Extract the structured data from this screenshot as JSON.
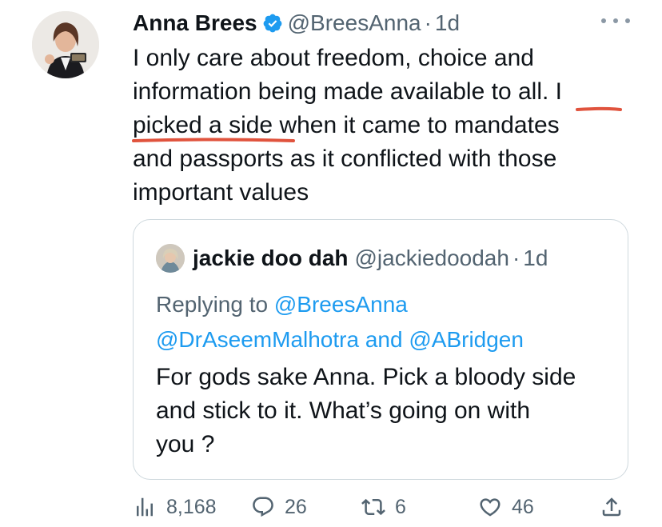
{
  "tweet": {
    "author": {
      "display_name": "Anna Brees",
      "handle": "@BreesAnna",
      "verified": true,
      "verified_color": "#1d9bf0"
    },
    "separator": "·",
    "time": "1d",
    "text_lines": [
      "I only care about freedom, choice and",
      "information being made available to all. I",
      "picked a side when it came to mandates",
      "and passports as it conflicted with those",
      "important values"
    ],
    "annotation_color": "#e0533d",
    "quoted_tweet": {
      "display_name": "jackie doo dah",
      "handle": "@jackiedoodah",
      "separator": "·",
      "time": "1d",
      "replying_to_label": "Replying to",
      "mention_1": "@BreesAnna",
      "mention_2": "@DrAseemMalhotra",
      "mentions_joiner": "and",
      "mention_3": "@ABridgen",
      "text_lines": [
        "For gods sake Anna. Pick a bloody side",
        "and stick to it. What’s going on with",
        "you ?"
      ]
    },
    "actions": {
      "views": {
        "icon": "analytics-icon",
        "count": "8,168"
      },
      "replies": {
        "icon": "reply-icon",
        "count": "26"
      },
      "retweets": {
        "icon": "retweet-icon",
        "count": "6"
      },
      "likes": {
        "icon": "heart-icon",
        "count": "46"
      },
      "share": {
        "icon": "share-icon"
      }
    },
    "colors": {
      "text": "#0f1419",
      "secondary": "#536471",
      "link": "#1d9bf0",
      "border": "#cfd9de"
    }
  }
}
